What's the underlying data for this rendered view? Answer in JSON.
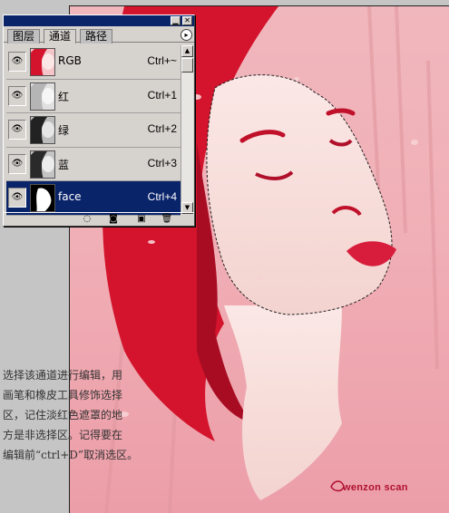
{
  "palette": {
    "title_min": "▁",
    "title_close": "✕",
    "tabs": [
      {
        "label": "图层"
      },
      {
        "label": "通道"
      },
      {
        "label": "路径"
      }
    ],
    "menu_arrow": "▸",
    "channels": [
      {
        "name": "RGB",
        "shortcut": "Ctrl+~"
      },
      {
        "name": "红",
        "shortcut": "Ctrl+1"
      },
      {
        "name": "绿",
        "shortcut": "Ctrl+2"
      },
      {
        "name": "蓝",
        "shortcut": "Ctrl+3"
      },
      {
        "name": "face",
        "shortcut": "Ctrl+4"
      }
    ],
    "eye_glyph": "👁",
    "footer_icons": [
      "selection-circle-icon",
      "mask-icon",
      "new-channel-icon",
      "trash-icon"
    ],
    "footer_glyphs": {
      "selection": "◌",
      "mask": "◙",
      "new": "▣",
      "trash": "🗑"
    }
  },
  "caption": {
    "lines": [
      "选择该通道进行编辑，用",
      "画笔和橡皮工具修饰选择",
      "区，记住淡红色遮罩的地",
      "方是非选择区。记得要在",
      "编辑前“ctrl+D”取消选区。"
    ]
  },
  "watermark": "wenzon scan",
  "colors": {
    "accent": "#0a246a",
    "canvas_pink": "#f0b7bd",
    "hair_red": "#d3142c"
  }
}
